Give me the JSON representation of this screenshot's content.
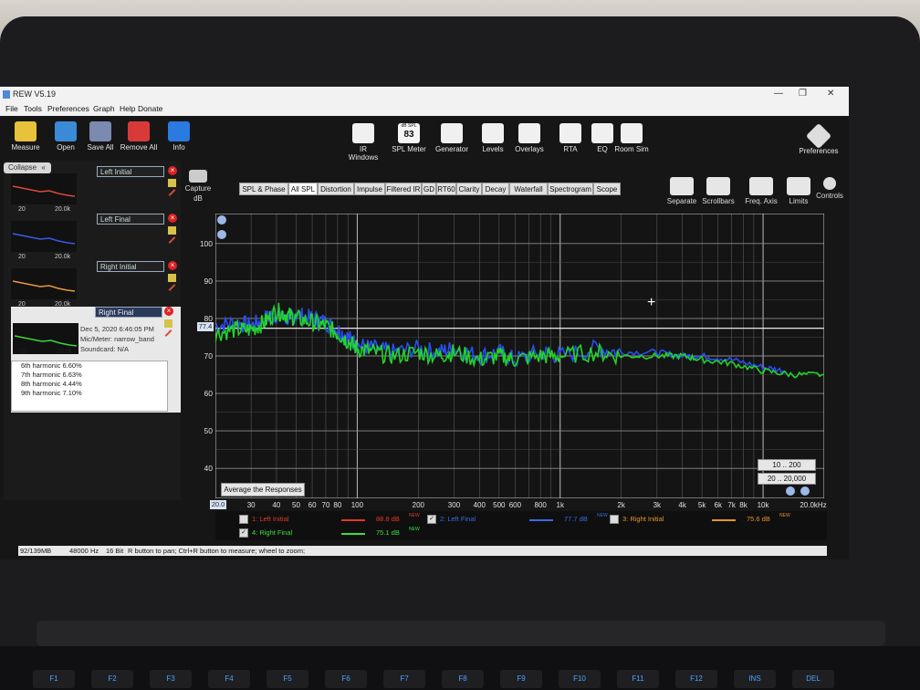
{
  "window": {
    "title": "REW V5.19"
  },
  "menu": [
    "File",
    "Tools",
    "Preferences",
    "Graph",
    "Help",
    "Donate"
  ],
  "toolbar_left": [
    {
      "label": "Measure",
      "icon": "measure-icon",
      "color": "#e8c23a"
    },
    {
      "label": "Open",
      "icon": "folder-icon",
      "color": "#3a8ad8"
    },
    {
      "label": "Save All",
      "icon": "save-icon",
      "color": "#7a8ab0"
    },
    {
      "label": "Remove All",
      "icon": "remove-icon",
      "color": "#d83a3a"
    },
    {
      "label": "Info",
      "icon": "info-icon",
      "color": "#2a7ae0"
    }
  ],
  "toolbar_center": [
    {
      "label": "IR Windows",
      "icon": "ir-windows-icon"
    },
    {
      "label": "SPL Meter",
      "icon": "spl-meter-icon",
      "badge_top": "dB SPL",
      "badge_value": "83"
    },
    {
      "label": "Generator",
      "icon": "generator-icon"
    },
    {
      "label": "Levels",
      "icon": "levels-icon"
    },
    {
      "label": "Overlays",
      "icon": "overlays-icon"
    },
    {
      "label": "RTA",
      "icon": "rta-icon"
    },
    {
      "label": "EQ",
      "icon": "eq-icon"
    },
    {
      "label": "Room Sim",
      "icon": "room-sim-icon"
    }
  ],
  "toolbar_right": {
    "label": "Preferences",
    "icon": "wrench-icon"
  },
  "panel": {
    "collapse_label": "Collapse",
    "measurements": [
      {
        "num": "1",
        "name": "Left Initial",
        "axis_lo": "20",
        "axis_hi": "20.0k",
        "color": "#d84a3a"
      },
      {
        "num": "2",
        "name": "Left Final",
        "axis_lo": "20",
        "axis_hi": "20.0k",
        "color": "#3a5ae8"
      },
      {
        "num": "3",
        "name": "Right Initial",
        "axis_lo": "20",
        "axis_hi": "20.0k",
        "color": "#e89a3a"
      },
      {
        "num": "4",
        "name": "Right Final",
        "axis_lo": "20",
        "axis_hi": "20.0k",
        "color": "#3ad83a"
      }
    ],
    "selected": {
      "date": "Dec 5, 2020 6:46:05 PM",
      "mic": "Mic/Meter: narrow_band",
      "soundcard": "Soundcard: N/A"
    },
    "harmonics": [
      "6th harmonic 6.60%",
      "7th harmonic 6.63%",
      "8th harmonic 4.44%",
      "9th harmonic 7.10%"
    ]
  },
  "capture": {
    "label": "Capture",
    "unit": "dB"
  },
  "tabs": [
    "SPL & Phase",
    "All SPL",
    "Distortion",
    "Impulse",
    "Filtered IR",
    "GD",
    "RT60",
    "Clarity",
    "Decay",
    "Waterfall",
    "Spectrogram",
    "Scope"
  ],
  "selected_tab": "All SPL",
  "graph_tools": [
    {
      "label": "Separate",
      "icon": "separate-icon"
    },
    {
      "label": "Scrollbars",
      "icon": "scrollbars-icon"
    },
    {
      "label": "Freq. Axis",
      "icon": "freq-axis-icon"
    },
    {
      "label": "Limits",
      "icon": "limits-icon"
    },
    {
      "label": "Controls",
      "icon": "gear-icon"
    }
  ],
  "graph_buttons": {
    "average": "Average the Responses",
    "range1": "10 .. 200",
    "range2": "20 .. 20,000"
  },
  "cursor": {
    "y_readout": "77.4",
    "x_readout": "20.0"
  },
  "chart_data": {
    "type": "line",
    "xlabel": "",
    "ylabel": "dB",
    "x_scale": "log",
    "xlim": [
      20,
      20000
    ],
    "ylim": [
      32,
      108
    ],
    "grid": true,
    "x_tick_labels": [
      "30",
      "40",
      "50",
      "60",
      "70",
      "80",
      "100",
      "200",
      "300",
      "400",
      "500",
      "600",
      "800",
      "1k",
      "2k",
      "3k",
      "4k",
      "5k",
      "6k",
      "7k",
      "8k",
      "10k",
      "20.0kHz"
    ],
    "y_tick_labels": [
      "100",
      "90",
      "80",
      "70",
      "60",
      "50",
      "40"
    ],
    "reference_line": 77.4,
    "series": [
      {
        "name": "2: Left Final",
        "color": "#2a4ef0",
        "x": [
          20,
          25,
          30,
          35,
          40,
          45,
          50,
          60,
          70,
          80,
          90,
          100,
          120,
          150,
          200,
          250,
          300,
          400,
          500,
          600,
          800,
          1000,
          1500,
          2000,
          3000,
          4000,
          5000,
          7000,
          10000,
          13000
        ],
        "y": [
          78,
          79,
          78,
          80,
          81,
          80,
          81,
          80,
          79,
          77,
          75,
          73,
          72,
          71,
          72,
          71,
          72,
          70,
          71,
          69,
          71,
          70,
          72,
          71,
          71,
          70,
          70,
          69,
          67,
          66
        ]
      },
      {
        "name": "4: Right Final",
        "color": "#22d42a",
        "x": [
          20,
          25,
          30,
          35,
          40,
          45,
          50,
          60,
          70,
          80,
          90,
          100,
          120,
          150,
          200,
          250,
          300,
          400,
          500,
          600,
          800,
          1000,
          1500,
          2000,
          3000,
          4000,
          5000,
          7000,
          10000,
          14000,
          20000
        ],
        "y": [
          76,
          77,
          77,
          79,
          82,
          81,
          80,
          79,
          78,
          76,
          74,
          72,
          71,
          70,
          71,
          70,
          71,
          69,
          70,
          69,
          70,
          70,
          71,
          70,
          70,
          70,
          69,
          68,
          66,
          65,
          65
        ]
      }
    ]
  },
  "legend": [
    {
      "label": "1: Left Initial",
      "value": "88.8 dB",
      "tag": "NEW",
      "color": "#e03a2a",
      "checked": false
    },
    {
      "label": "2: Left Final",
      "value": "77.7 dB",
      "tag": "NEW",
      "color": "#3a6ae8",
      "checked": true
    },
    {
      "label": "3: Right Initial",
      "value": "75.6 dB",
      "tag": "NEW",
      "color": "#e8942a",
      "checked": false
    },
    {
      "label": "4: Right Final",
      "value": "75.1 dB",
      "tag": "NEW",
      "color": "#3ae03a",
      "checked": true
    }
  ],
  "status": {
    "memory": "92/139MB",
    "rate": "48000 Hz",
    "bits": "16 Bit",
    "hint": "R button to pan; Ctrl+R button to measure; wheel to zoom;"
  },
  "keyboard": [
    "F1",
    "F2",
    "F3",
    "F4",
    "F5",
    "F6",
    "F7",
    "F8",
    "F9",
    "F10",
    "F11",
    "F12",
    "INS",
    "DEL"
  ]
}
